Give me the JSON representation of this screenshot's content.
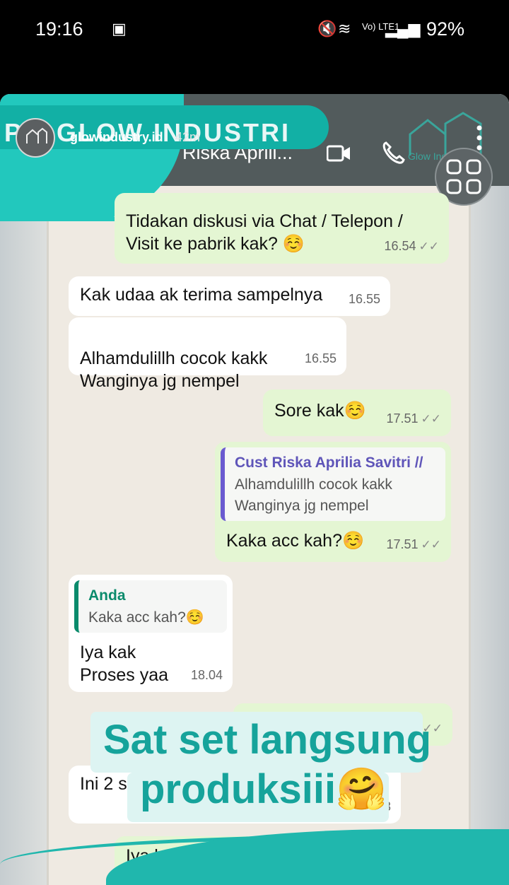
{
  "status_bar": {
    "time": "19:16",
    "mute_icon": "mute-icon",
    "signal_label": "Vo) LTE1",
    "battery": "92%"
  },
  "story": {
    "banner_title": "PT. GLOW INDUSTRI",
    "username": "glowindustry.id",
    "time_ago": "42m",
    "chat_name": "Riska Aprili...",
    "logo_text": "Glow Industry"
  },
  "messages": [
    {
      "type": "out",
      "text": "Tidakan diskusi via Chat / Telepon / Visit ke pabrik kak? ☺️",
      "time": "16.54"
    },
    {
      "type": "in",
      "text": "Kak udaa ak terima sampelnya",
      "time": "16.55"
    },
    {
      "type": "in",
      "text": "Alhamdulillh cocok kakk\nWanginya jg nempel",
      "time": "16.55"
    },
    {
      "type": "out",
      "text": "Sore kak☺️",
      "time": "17.51"
    },
    {
      "type": "out",
      "quote_author": "Cust Riska Aprilia Savitri //",
      "quote_text": "Alhamdulillh cocok kakk\nWanginya jg nempel",
      "text": "Kaka acc kah?☺️",
      "time": "17.51"
    },
    {
      "type": "in",
      "quote_author": "Anda",
      "quote_text": "Kaka acc kah?☺️",
      "text": "Iya kak\nProses yaa",
      "time": "18.04"
    },
    {
      "type": "in",
      "text": "Ini 2 s",
      "time": "3"
    },
    {
      "type": "in",
      "text": "Iya kak betul",
      "time": ""
    }
  ],
  "overlay": {
    "line1": "Sat set langsung",
    "line2": "produksiii🤗"
  },
  "colors": {
    "teal": "#16a39b",
    "incoming": "#ffffff",
    "outgoing": "#e4f6d3"
  }
}
